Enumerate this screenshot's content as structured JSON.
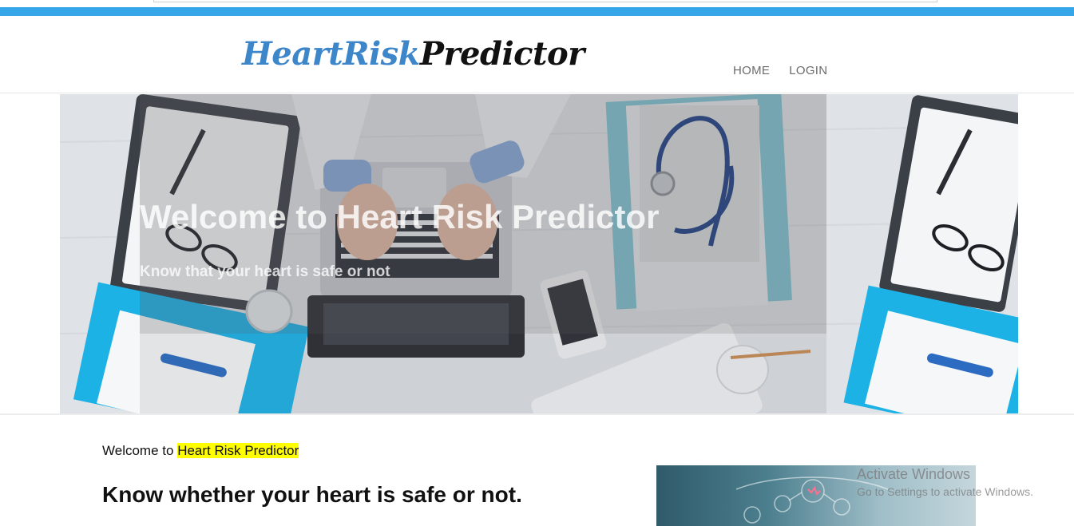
{
  "brand": {
    "part1": "HeartRisk",
    "part2": "Predictor"
  },
  "nav": {
    "items": [
      {
        "label": "HOME"
      },
      {
        "label": "LOGIN"
      }
    ]
  },
  "hero": {
    "title": "Welcome to Heart Risk Predictor",
    "subtitle": "Know that your heart is safe or not"
  },
  "content": {
    "welcome_prefix": "Welcome to",
    "welcome_highlight": "Heart Risk Predictor",
    "headline": "Know whether your heart is safe or not."
  },
  "watermark": {
    "title": "Activate Windows",
    "subtitle": "Go to Settings to activate Windows."
  },
  "colors": {
    "accent_bar": "#35a6e8",
    "logo_blue": "#3d86c9",
    "highlight": "#ffff00"
  }
}
